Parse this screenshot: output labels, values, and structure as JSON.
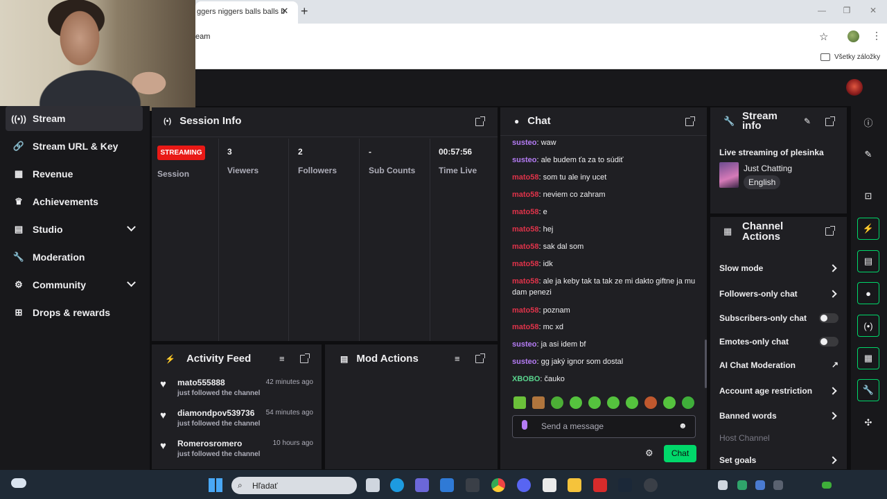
{
  "browser": {
    "tab_title": "ggers niggers balls balls b",
    "address": "eam",
    "bookmarks_label": "Všetky záložky"
  },
  "nav": {
    "items": [
      {
        "label": "Stream",
        "icon": "stream-icon",
        "active": true
      },
      {
        "label": "Stream URL & Key",
        "icon": "link-icon"
      },
      {
        "label": "Revenue",
        "icon": "revenue-icon"
      },
      {
        "label": "Achievements",
        "icon": "trophy-icon"
      },
      {
        "label": "Studio",
        "icon": "studio-icon",
        "expandable": true
      },
      {
        "label": "Moderation",
        "icon": "wrench-icon"
      },
      {
        "label": "Community",
        "icon": "community-icon",
        "expandable": true
      },
      {
        "label": "Drops & rewards",
        "icon": "gift-icon"
      }
    ]
  },
  "session": {
    "title": "Session Info",
    "status": "STREAMING",
    "status_label": "Session",
    "stats": [
      {
        "value": "3",
        "label": "Viewers"
      },
      {
        "value": "2",
        "label": "Followers"
      },
      {
        "value": "-",
        "label": "Sub Counts"
      },
      {
        "value": "00:57:56",
        "label": "Time Live"
      }
    ]
  },
  "activity": {
    "title": "Activity Feed",
    "items": [
      {
        "name": "mato555888",
        "time": "42 minutes ago",
        "desc": "just followed the channel"
      },
      {
        "name": "diamondpov539736",
        "time": "54 minutes ago",
        "desc": "just followed the channel"
      },
      {
        "name": "Romerosromero",
        "time": "10 hours ago",
        "desc": "just followed the channel"
      }
    ]
  },
  "mod_actions": {
    "title": "Mod Actions"
  },
  "chat": {
    "title": "Chat",
    "messages": [
      {
        "user": "susteo",
        "text": ": waw"
      },
      {
        "user": "susteo",
        "text": ": ale budem ťa za to súdiť"
      },
      {
        "user": "mato58",
        "text": ": som tu ale iny ucet"
      },
      {
        "user": "mato58",
        "text": ": neviem co zahram"
      },
      {
        "user": "mato58",
        "text": ": e"
      },
      {
        "user": "mato58",
        "text": ": hej"
      },
      {
        "user": "mato58",
        "text": ": sak dal som"
      },
      {
        "user": "mato58",
        "text": ": idk"
      },
      {
        "user": "mato58",
        "text": ": ale ja keby tak ta tak ze mi dakto giftne ja mu dam penezi"
      },
      {
        "user": "mato58",
        "text": ": poznam"
      },
      {
        "user": "mato58",
        "text": ": mc xd"
      },
      {
        "user": "susteo",
        "text": ": ja asi idem bf"
      },
      {
        "user": "susteo",
        "text": ": gg jaký ignor som dostal"
      },
      {
        "user": "XBOBO",
        "text": ": čauko"
      }
    ],
    "input_placeholder": "Send a message",
    "send_label": "Chat"
  },
  "stream_info": {
    "title_line1": "Stream",
    "title_line2": "info",
    "stream_title": "Live streaming of plesinka",
    "category": "Just Chatting",
    "language": "English"
  },
  "channel_actions": {
    "title_line1": "Channel",
    "title_line2": "Actions",
    "rows": [
      {
        "label": "Slow mode",
        "control": "chevron"
      },
      {
        "label": "Followers-only chat",
        "control": "chevron"
      },
      {
        "label": "Subscribers-only chat",
        "control": "toggle",
        "on": false
      },
      {
        "label": "Emotes-only chat",
        "control": "toggle",
        "on": false
      },
      {
        "label": "AI Chat Moderation",
        "control": "external"
      },
      {
        "label": "Account age restriction",
        "control": "chevron"
      },
      {
        "label": "Banned words",
        "control": "chevron"
      },
      {
        "label": "Host Channel",
        "control": "none",
        "disabled": true
      },
      {
        "label": "Set goals",
        "control": "chevron"
      }
    ]
  },
  "taskbar": {
    "search_placeholder": "Hľadať"
  },
  "colors": {
    "accent_green": "#00d86a",
    "live_red": "#e91916",
    "susteo": "#b57cf5",
    "mato58": "#e0334a",
    "xbobo": "#5ad68f"
  }
}
